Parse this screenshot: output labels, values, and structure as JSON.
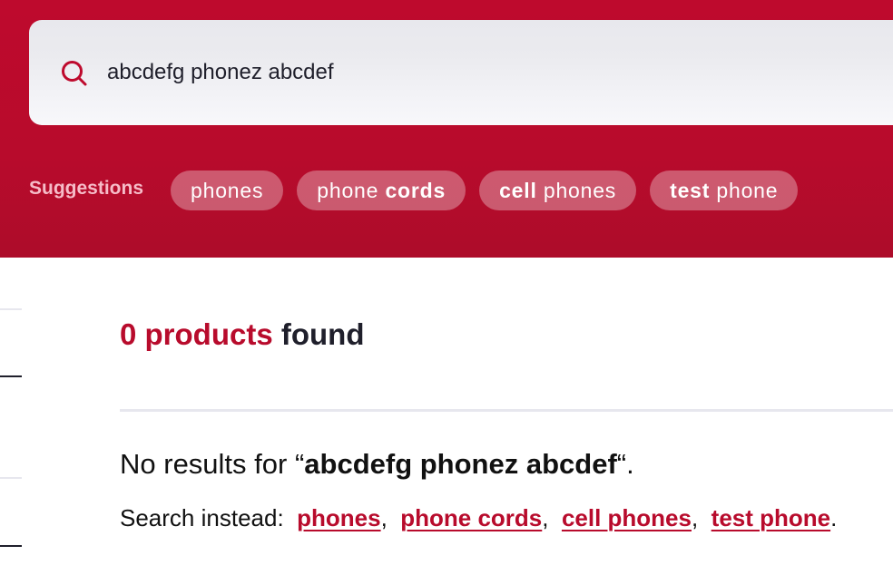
{
  "search": {
    "value": "abcdefg phonez abcdef",
    "icon": "search-icon"
  },
  "suggestions": {
    "label": "Suggestions",
    "items": [
      {
        "plain_before": "phones",
        "bold": "",
        "plain_after": ""
      },
      {
        "plain_before": "phone ",
        "bold": "cords",
        "plain_after": ""
      },
      {
        "plain_before": "",
        "bold": "cell",
        "plain_after": " phones"
      },
      {
        "plain_before": "",
        "bold": "test",
        "plain_after": " phone"
      }
    ]
  },
  "results": {
    "count_accent": "0 products",
    "count_rest": " found",
    "no_results_prefix": "No results for “",
    "no_results_query": "abcdefg phonez abcdef",
    "no_results_suffix": "“.",
    "search_instead_label": "Search instead:  ",
    "alternatives": [
      "phones",
      "phone cords",
      "cell phones",
      "test phone"
    ],
    "separator": ",  ",
    "end": "."
  },
  "colors": {
    "brand": "#be0a2d",
    "link": "#b80b2c",
    "text": "#1f1f2b"
  }
}
